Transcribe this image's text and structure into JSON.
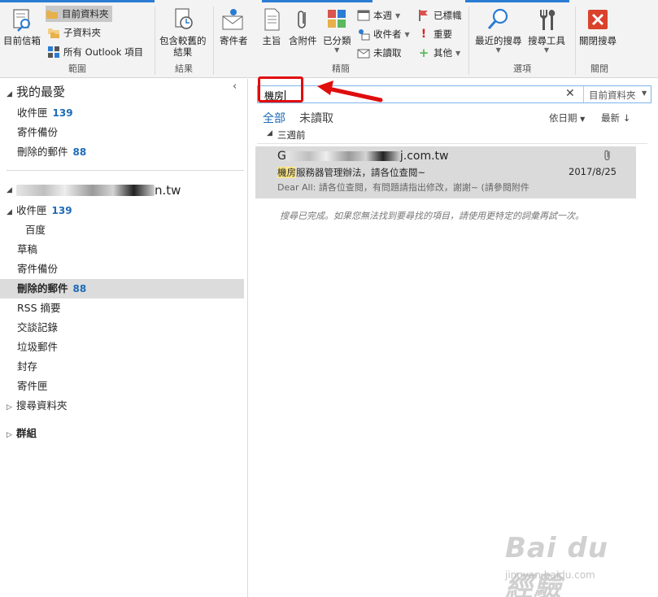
{
  "ribbon": {
    "groups": {
      "scope_label": "範圍",
      "results_label": "結果",
      "refine_label": "精簡",
      "options_label": "選項",
      "close_label": "關閉"
    },
    "buttons": {
      "current_mailbox": "目前信箱",
      "current_folder": "目前資料夾",
      "subfolders": "子資料夾",
      "all_outlook": "所有 Outlook 項目",
      "include_older_1": "包含較舊的",
      "include_older_2": "結果",
      "from": "寄件者",
      "subject": "主旨",
      "has_attachments": "含附件",
      "categorized": "已分類",
      "this_week": "本週",
      "sent_to": "收件者",
      "unread": "未讀取",
      "flagged": "已標幟",
      "important": "重要",
      "more": "其他",
      "recent_searches": "最近的搜尋",
      "search_tools": "搜尋工具",
      "close_search": "關閉搜尋"
    }
  },
  "left": {
    "favorites_header": "我的最愛",
    "favorites": [
      {
        "label": "收件匣",
        "count": "139"
      },
      {
        "label": "寄件備份",
        "count": ""
      },
      {
        "label": "刪除的郵件",
        "count": "88"
      }
    ],
    "account_suffix": "n.tw",
    "folders": [
      {
        "label": "收件匣",
        "count": "139"
      },
      {
        "label": "百度",
        "count": ""
      },
      {
        "label": "草稿",
        "count": ""
      },
      {
        "label": "寄件備份",
        "count": ""
      },
      {
        "label": "刪除的郵件",
        "count": "88"
      },
      {
        "label": "RSS 摘要",
        "count": ""
      },
      {
        "label": "交談記錄",
        "count": ""
      },
      {
        "label": "垃圾郵件",
        "count": ""
      },
      {
        "label": "封存",
        "count": ""
      },
      {
        "label": "寄件匣",
        "count": ""
      },
      {
        "label": "搜尋資料夾",
        "count": ""
      }
    ],
    "groups": "群組"
  },
  "search": {
    "query": "機房",
    "scope": "目前資料夾"
  },
  "filters": {
    "all": "全部",
    "unread": "未讀取",
    "sort_by": "依日期",
    "order": "最新"
  },
  "list": {
    "group_header": "三週前",
    "item": {
      "sender_start": "G",
      "sender_end": "j.com.tw",
      "subject_highlight": "機房",
      "subject_rest": "服務器管理辦法，請各位查閱~",
      "date": "2017/8/25",
      "preview": "Dear All:  請各位查閱，有問題請指出修改，謝謝~  (請參閱附件"
    },
    "search_complete": "搜尋已完成。如果您無法找到要尋找的項目，請使用更特定的詞彙再試一次。"
  },
  "watermark": {
    "main": "Bai du 經驗",
    "sub": "jingyan.baidu.com"
  },
  "colors": {
    "accent": "#1e6bb8",
    "annotation_red": "#e00d0d",
    "highlight": "#fde98b",
    "selected_bg": "#dadada"
  }
}
